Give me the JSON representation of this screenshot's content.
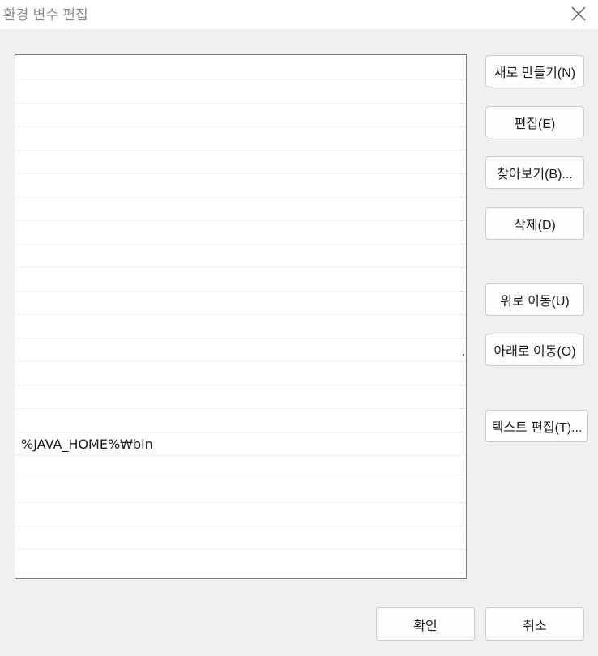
{
  "window": {
    "title": "환경 변수 편집",
    "close_icon": "close-icon"
  },
  "path_list": {
    "entries": [
      "",
      "",
      "",
      "",
      "",
      "",
      "",
      "",
      "",
      "",
      "",
      "",
      "",
      "",
      "",
      "",
      "%JAVA_HOME%₩bin",
      "",
      "",
      "",
      "",
      "",
      ""
    ],
    "selected_index": null
  },
  "actions": {
    "new": "새로 만들기(N)",
    "edit": "편집(E)",
    "browse": "찾아보기(B)...",
    "delete": "삭제(D)",
    "move_up": "위로 이동(U)",
    "move_down": "아래로 이동(O)",
    "edit_text": "텍스트 편집(T)..."
  },
  "footer": {
    "ok": "확인",
    "cancel": "취소"
  },
  "colors": {
    "window_bg": "#f0f0f0",
    "titlebar_bg": "#ffffff",
    "list_bg": "#ffffff",
    "list_border": "#7a7a7a",
    "button_border": "#cccccc"
  }
}
